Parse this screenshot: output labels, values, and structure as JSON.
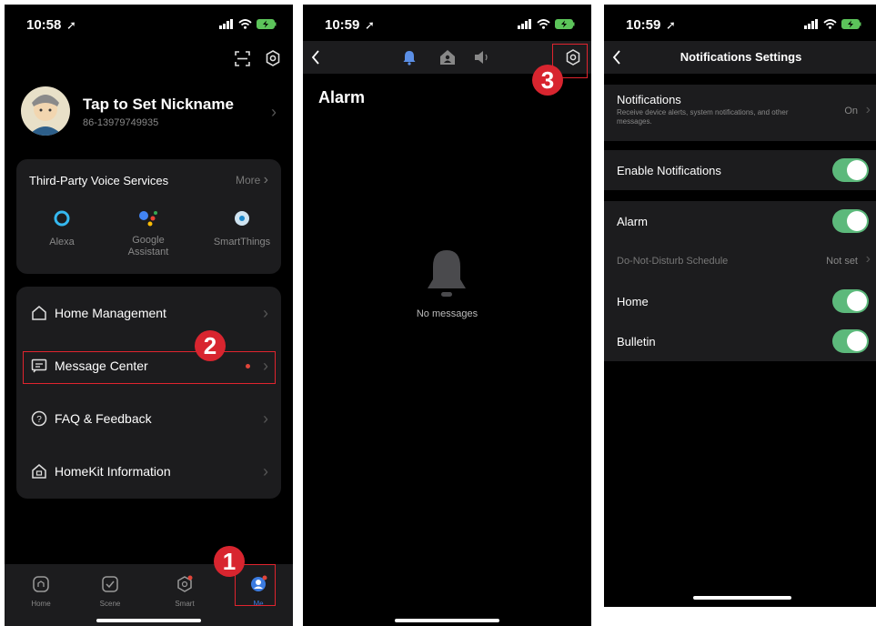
{
  "screen1": {
    "time": "10:58",
    "profile": {
      "nickname": "Tap to Set Nickname",
      "phone": "86-13979749935"
    },
    "voice": {
      "title": "Third-Party Voice Services",
      "more": "More",
      "services": [
        {
          "label": "Alexa"
        },
        {
          "label": "Google\nAssistant"
        },
        {
          "label": "SmartThings"
        }
      ]
    },
    "menu": [
      {
        "label": "Home Management"
      },
      {
        "label": "Message Center"
      },
      {
        "label": "FAQ & Feedback"
      },
      {
        "label": "HomeKit Information"
      }
    ],
    "tabs": [
      {
        "label": "Home"
      },
      {
        "label": "Scene"
      },
      {
        "label": "Smart"
      },
      {
        "label": "Me"
      }
    ],
    "markers": {
      "m1": "1",
      "m2": "2"
    }
  },
  "screen2": {
    "time": "10:59",
    "title": "Alarm",
    "empty": "No messages",
    "marker": "3"
  },
  "screen3": {
    "time": "10:59",
    "title": "Notifications Settings",
    "notifications": {
      "label": "Notifications",
      "desc": "Receive device alerts, system notifications, and other messages.",
      "value": "On"
    },
    "enable": "Enable Notifications",
    "alarm": "Alarm",
    "dnd": {
      "label": "Do-Not-Disturb Schedule",
      "value": "Not set"
    },
    "home": "Home",
    "bulletin": "Bulletin"
  },
  "colors": {
    "accent_blue": "#3b7be0",
    "toggle_green": "#5cb97b",
    "marker_red": "#d8252f"
  }
}
